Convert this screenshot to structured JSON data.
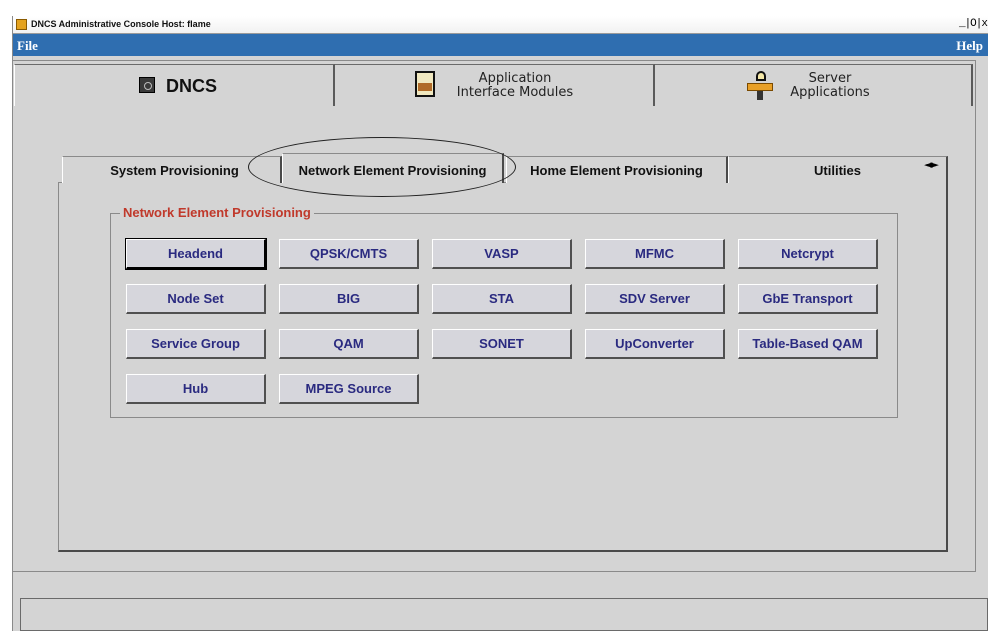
{
  "window": {
    "title": "DNCS Administrative Console  Host: flame",
    "controls": "_|O|x"
  },
  "menubar": {
    "file": "File",
    "help": "Help"
  },
  "top_tabs": [
    {
      "label": "DNCS",
      "icon": "dncs-icon"
    },
    {
      "label": "Application\nInterface Modules",
      "icon": "application-module-icon"
    },
    {
      "label": "Server\nApplications",
      "icon": "server-applications-icon"
    }
  ],
  "sub_tabs": [
    "System Provisioning",
    "Network Element Provisioning",
    "Home Element Provisioning",
    "Utilities"
  ],
  "scroll_arrows": "◄►",
  "group": {
    "title": "Network Element Provisioning",
    "title_color": "#c0392b",
    "buttons": [
      [
        "Headend",
        "QPSK/CMTS",
        "VASP",
        "MFMC",
        "Netcrypt"
      ],
      [
        "Node Set",
        "BIG",
        "STA",
        "SDV Server",
        "GbE Transport"
      ],
      [
        "Service Group",
        "QAM",
        "SONET",
        "UpConverter",
        "Table-Based QAM"
      ],
      [
        "Hub",
        "MPEG Source"
      ]
    ]
  },
  "colors": {
    "menubar": "#2f6eb0",
    "button_text": "#2a2a80",
    "background": "#d4d4d4"
  }
}
